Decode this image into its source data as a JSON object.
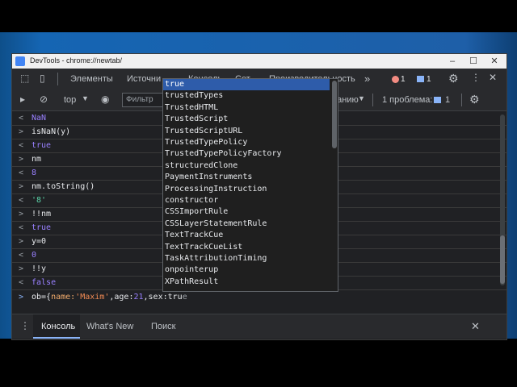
{
  "window": {
    "title": "DevTools - chrome://newtab/"
  },
  "tabs": [
    {
      "label": "Элементы"
    },
    {
      "label": "Источни"
    },
    {
      "label": "Консоль"
    },
    {
      "label": "Сет"
    },
    {
      "label": "Производительность"
    }
  ],
  "tab_overflow": "»",
  "errors_count": "1",
  "messages_count": "1",
  "toolbar": {
    "context": "top",
    "filter_placeholder": "Фильтр",
    "levels": "ианию",
    "issues_label": "1 проблема:",
    "issues_count": "1"
  },
  "console_rows": [
    {
      "arrow": "<",
      "text": "NaN",
      "kind": "purple"
    },
    {
      "arrow": ">",
      "text": "isNaN(y)",
      "kind": "input"
    },
    {
      "arrow": "<",
      "text": "true",
      "kind": "purple"
    },
    {
      "arrow": ">",
      "text": "nm",
      "kind": "input"
    },
    {
      "arrow": "<",
      "text": "8",
      "kind": "purple"
    },
    {
      "arrow": ">",
      "text": "nm.toString()",
      "kind": "input"
    },
    {
      "arrow": "<",
      "text": "'8'",
      "kind": "green"
    },
    {
      "arrow": ">",
      "text": "!!nm",
      "kind": "input"
    },
    {
      "arrow": "<",
      "text": "true",
      "kind": "purple"
    },
    {
      "arrow": ">",
      "text": "y=0",
      "kind": "input"
    },
    {
      "arrow": "<",
      "text": "0",
      "kind": "purple"
    },
    {
      "arrow": ">",
      "text": "!!y",
      "kind": "input"
    },
    {
      "arrow": "<",
      "text": "false",
      "kind": "purple"
    }
  ],
  "prompt": {
    "arrow": ">",
    "p1": "ob={",
    "p2": "name:",
    "p3": "'Maxim'",
    "p4": ",age:",
    "p5": "21",
    "p6": ",sex:tru",
    "p7": "e"
  },
  "autocomplete": [
    "true",
    "trustedTypes",
    "TrustedHTML",
    "TrustedScript",
    "TrustedScriptURL",
    "TrustedTypePolicy",
    "TrustedTypePolicyFactory",
    "structuredClone",
    "PaymentInstruments",
    "ProcessingInstruction",
    "constructor",
    "CSSImportRule",
    "CSSLayerStatementRule",
    "TextTrackCue",
    "TextTrackCueList",
    "TaskAttributionTiming",
    "onpointerup",
    "XPathResult"
  ],
  "drawer": {
    "tabs": [
      "Консоль",
      "What's New",
      "Поиск"
    ]
  }
}
